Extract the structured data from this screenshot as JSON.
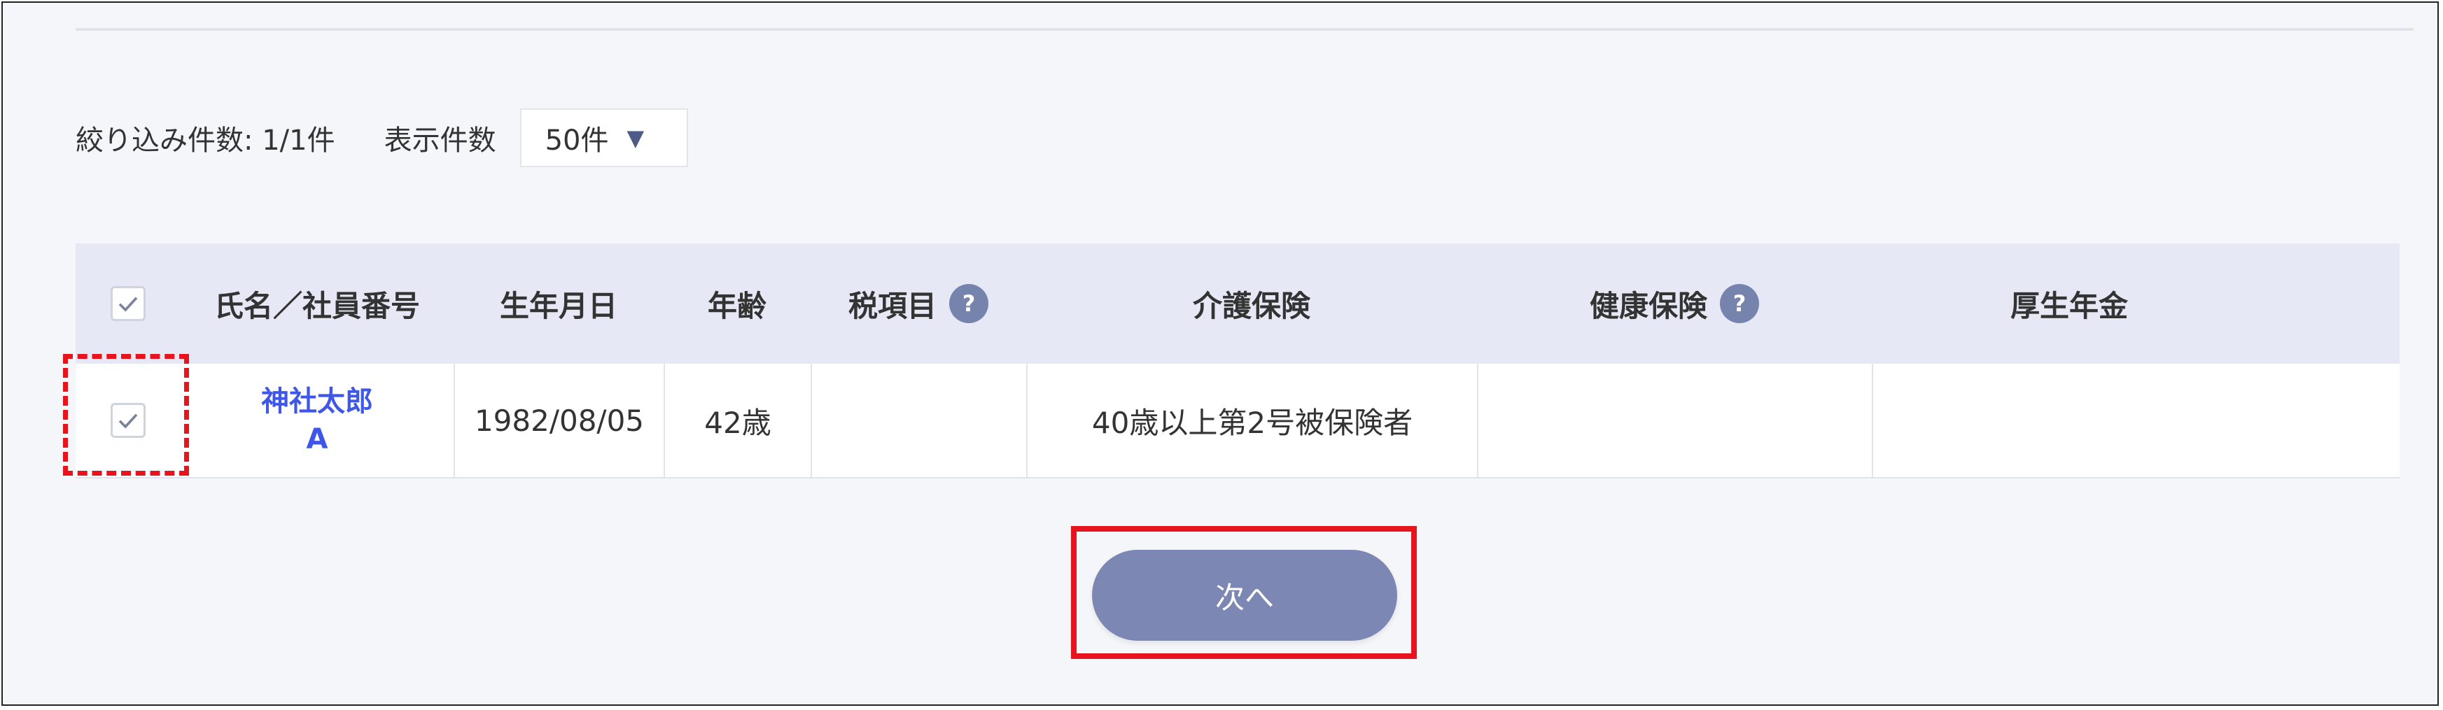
{
  "filter": {
    "count_label": "絞り込み件数: 1/1件",
    "per_page_label": "表示件数",
    "per_page_value": "50件",
    "caret": "▼"
  },
  "table": {
    "headers": {
      "name": "氏名／社員番号",
      "birthday": "生年月日",
      "age": "年齢",
      "tax": "税項目",
      "care": "介護保険",
      "health": "健康保険",
      "pension": "厚生年金"
    },
    "help_icon": "?",
    "rows": [
      {
        "name": "神社太郎",
        "employee_no": "A",
        "birthday": "1982/08/05",
        "age": "42歳",
        "tax": "",
        "care": "40歳以上第2号被保険者",
        "health": "",
        "pension": ""
      }
    ]
  },
  "next_button": {
    "label": "次へ"
  },
  "colors": {
    "accent": "#7c87b3",
    "highlight": "#e8141d",
    "link": "#3f57e6"
  }
}
